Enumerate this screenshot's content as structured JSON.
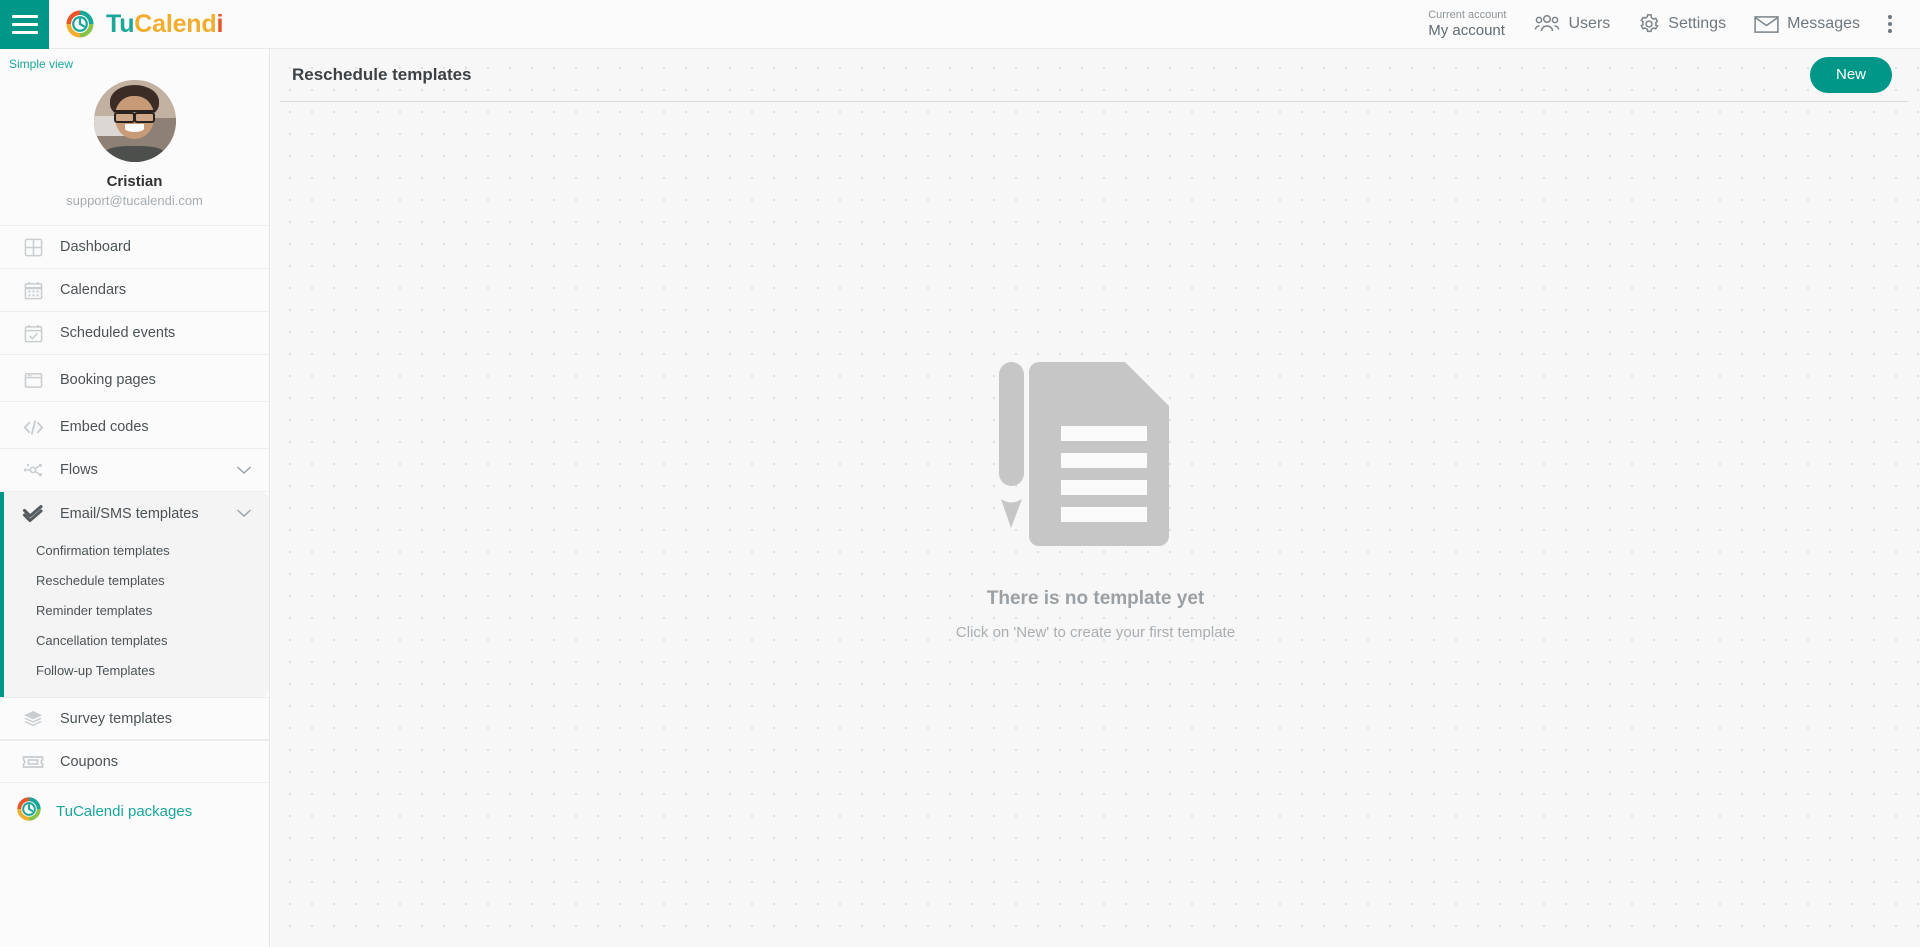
{
  "topbar": {
    "menu_icon": "hamburger-icon",
    "brand": {
      "part1": "Tu",
      "part2": "Calend",
      "part3": "i",
      "logo_icon": "tucalendi-logo-icon"
    },
    "account": {
      "label": "Current account",
      "value": "My account"
    },
    "items": [
      {
        "label": "Users",
        "icon": "users-icon"
      },
      {
        "label": "Settings",
        "icon": "gear-icon"
      },
      {
        "label": "Messages",
        "icon": "envelope-icon"
      }
    ],
    "overflow_icon": "kebab-menu-icon"
  },
  "sidebar": {
    "simple_view": "Simple view",
    "profile": {
      "name": "Cristian",
      "email": "support@tucalendi.com",
      "avatar_icon": "avatar"
    },
    "items": [
      {
        "label": "Dashboard",
        "icon": "dashboard-grid-icon"
      },
      {
        "label": "Calendars",
        "icon": "calendar-icon"
      },
      {
        "label": "Scheduled events",
        "icon": "calendar-check-icon"
      },
      {
        "label": "Booking pages",
        "icon": "window-icon"
      },
      {
        "label": "Embed codes",
        "icon": "code-icon"
      },
      {
        "label": "Flows",
        "icon": "flow-nodes-icon",
        "expandable": true
      }
    ],
    "active_section": {
      "label": "Email/SMS templates",
      "icon": "double-check-icon",
      "expandable": true,
      "submenu": [
        "Confirmation templates",
        "Reschedule templates",
        "Reminder templates",
        "Cancellation templates",
        "Follow-up Templates"
      ]
    },
    "bottom_items": [
      {
        "label": "Survey templates",
        "icon": "layers-icon"
      },
      {
        "label": "Coupons",
        "icon": "ticket-icon"
      }
    ],
    "packages": {
      "label": "TuCalendi packages",
      "icon": "tucalendi-logo-icon"
    }
  },
  "main": {
    "page_title": "Reschedule templates",
    "new_button": "New",
    "empty_state": {
      "illustration": "document-with-pencil-icon",
      "title": "There is no template yet",
      "subtitle": "Click on 'New' to create your first template"
    }
  },
  "colors": {
    "accent": "#009688",
    "brand_teal": "#1aa79a",
    "brand_yellow": "#f0ad2e",
    "brand_red": "#e8552a",
    "brand_green": "#8bc34a",
    "text_primary": "#3c4246",
    "text_muted": "#a6adb2",
    "sidebar_bg": "#fbfbfb",
    "main_bg": "#f7f7f7",
    "illustration_gray": "#c6c6c6"
  }
}
